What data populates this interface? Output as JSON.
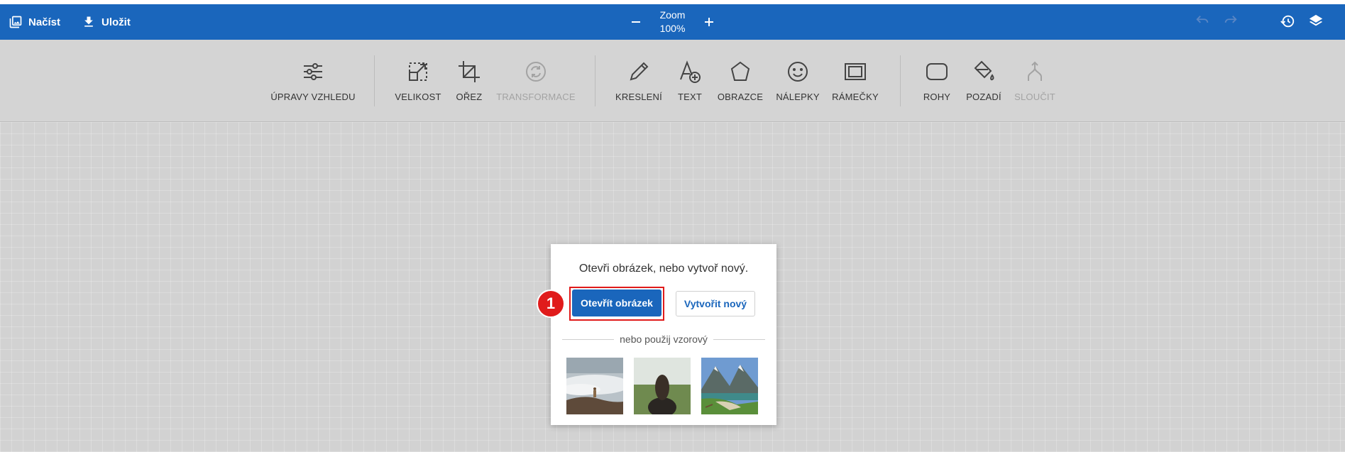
{
  "topbar": {
    "load_label": "Načíst",
    "save_label": "Uložit",
    "zoom_label": "Zoom",
    "zoom_value": "100%",
    "brand_color": "#1a66bc"
  },
  "toolbar": {
    "tools": [
      {
        "label": "ÚPRAVY VZHLEDU",
        "icon": "sliders-icon"
      },
      {
        "label": "VELIKOST",
        "icon": "resize-icon"
      },
      {
        "label": "OŘEZ",
        "icon": "crop-icon"
      },
      {
        "label": "TRANSFORMACE",
        "icon": "rotate-icon",
        "disabled": true
      },
      {
        "label": "KRESLENÍ",
        "icon": "pencil-icon"
      },
      {
        "label": "TEXT",
        "icon": "text-add-icon"
      },
      {
        "label": "OBRAZCE",
        "icon": "shapes-icon"
      },
      {
        "label": "NÁLEPKY",
        "icon": "smiley-icon"
      },
      {
        "label": "RÁMEČKY",
        "icon": "frame-icon"
      },
      {
        "label": "ROHY",
        "icon": "rounded-corners-icon"
      },
      {
        "label": "POZADÍ",
        "icon": "paint-bucket-icon"
      },
      {
        "label": "SLOUČIT",
        "icon": "merge-icon",
        "disabled": true
      }
    ]
  },
  "dialog": {
    "title": "Otevři obrázek, nebo vytvoř nový.",
    "open_label": "Otevřít obrázek",
    "new_label": "Vytvořit nový",
    "or_label": "nebo použij vzorový",
    "step_marker": "1",
    "highlight_color": "#e01b1b"
  }
}
